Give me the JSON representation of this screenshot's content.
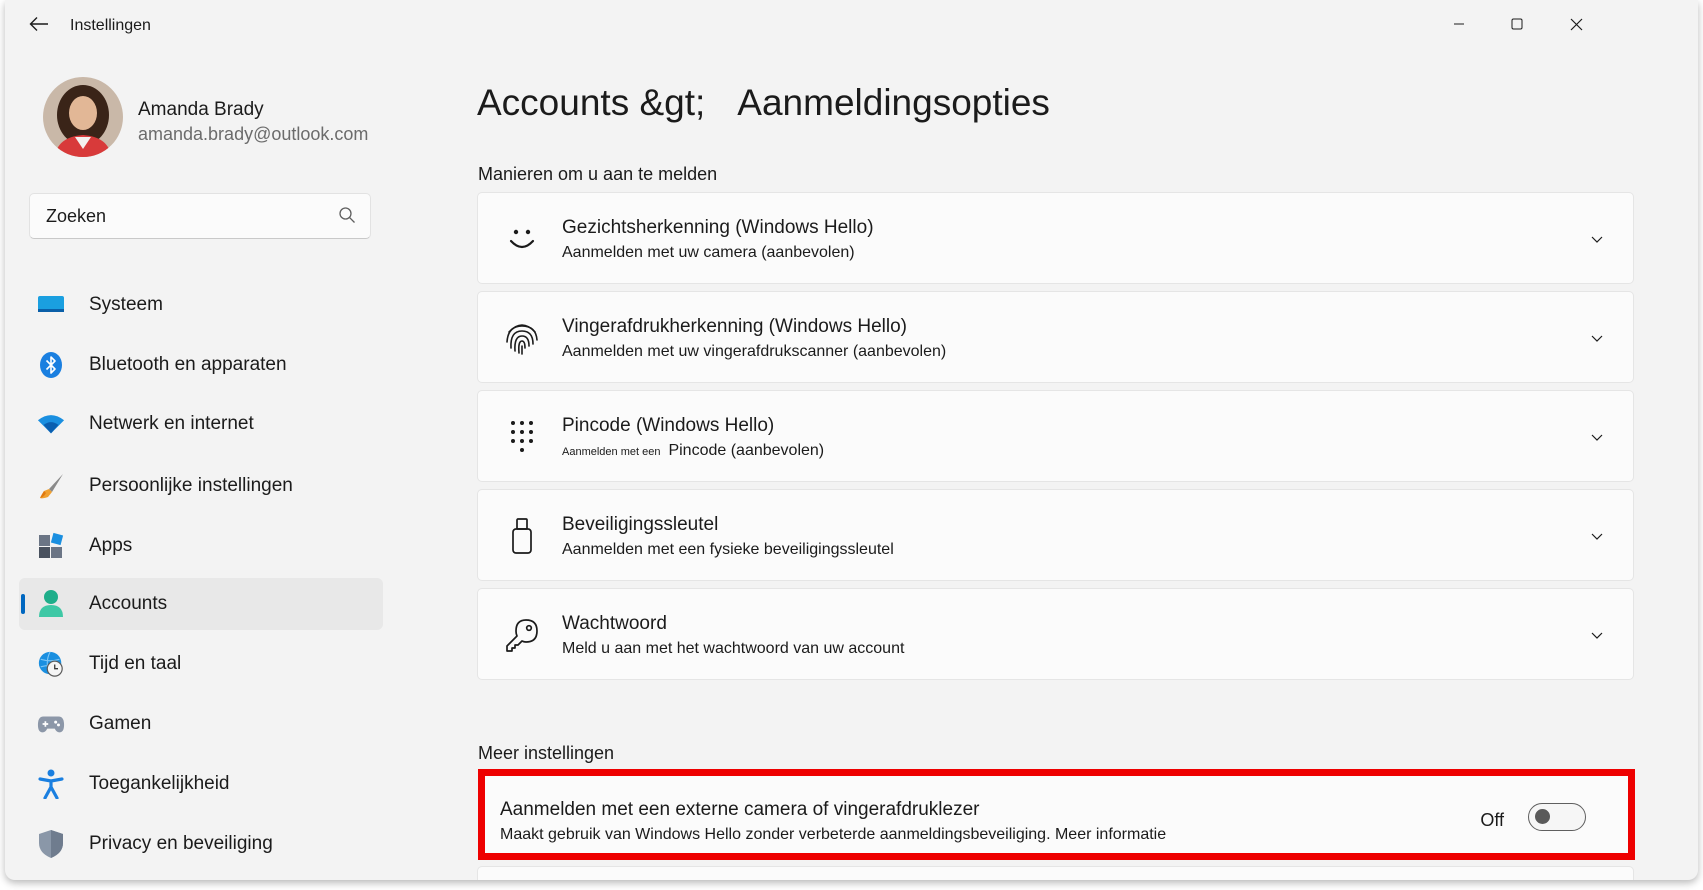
{
  "window": {
    "title": "Instellingen"
  },
  "profile": {
    "name": "Amanda Brady",
    "email": "amanda.brady@outlook.com"
  },
  "search": {
    "placeholder": "Zoeken"
  },
  "sidebar": {
    "items": [
      {
        "label": "Systeem",
        "icon": "system-icon"
      },
      {
        "label": "Bluetooth en apparaten",
        "icon": "bluetooth-icon"
      },
      {
        "label": "Netwerk en internet",
        "icon": "wifi-icon"
      },
      {
        "label": "Persoonlijke instellingen",
        "icon": "paintbrush-icon"
      },
      {
        "label": "Apps",
        "icon": "apps-icon"
      },
      {
        "label": "Accounts",
        "icon": "accounts-icon",
        "selected": true
      },
      {
        "label": "Tijd en taal",
        "icon": "globe-clock-icon"
      },
      {
        "label": "Gamen",
        "icon": "gamepad-icon"
      },
      {
        "label": "Toegankelijkheid",
        "icon": "accessibility-icon"
      },
      {
        "label": "Privacy en beveiliging",
        "icon": "shield-icon"
      }
    ]
  },
  "header": {
    "breadcrumb_parent": "Accounts &gt;",
    "breadcrumb_current": "Aanmeldingsopties"
  },
  "sections": {
    "signin_header": "Manieren om u aan te melden",
    "more_header": "Meer instellingen"
  },
  "signin_options": [
    {
      "title": "Gezichtsherkenning (Windows Hello)",
      "subtitle": "Aanmelden met uw camera (aanbevolen)",
      "icon": "face-icon"
    },
    {
      "title": "Vingerafdrukherkenning (Windows Hello)",
      "subtitle": "Aanmelden met uw vingerafdrukscanner (aanbevolen)",
      "icon": "fingerprint-icon"
    },
    {
      "title": "Pincode (Windows Hello)",
      "subtitle_small": "Aanmelden met een",
      "subtitle": "Pincode (aanbevolen)",
      "icon": "pin-keypad-icon"
    },
    {
      "title": "Beveiligingssleutel",
      "subtitle": "Aanmelden met een fysieke beveiligingssleutel",
      "icon": "usb-key-icon"
    },
    {
      "title": "Wachtwoord",
      "subtitle": "Meld u aan met het wachtwoord van uw account",
      "icon": "key-icon"
    }
  ],
  "external_signin": {
    "title": "Aanmelden met een externe camera of vingerafdruklezer",
    "subtitle": "Maakt gebruik van Windows Hello zonder verbeterde aanmeldingsbeveiliging. Meer informatie",
    "toggle_state": "Off",
    "highlight_color": "#ee0000"
  },
  "colors": {
    "accent": "#0067c0",
    "background": "#f3f3f3",
    "card": "#fbfbfb"
  }
}
